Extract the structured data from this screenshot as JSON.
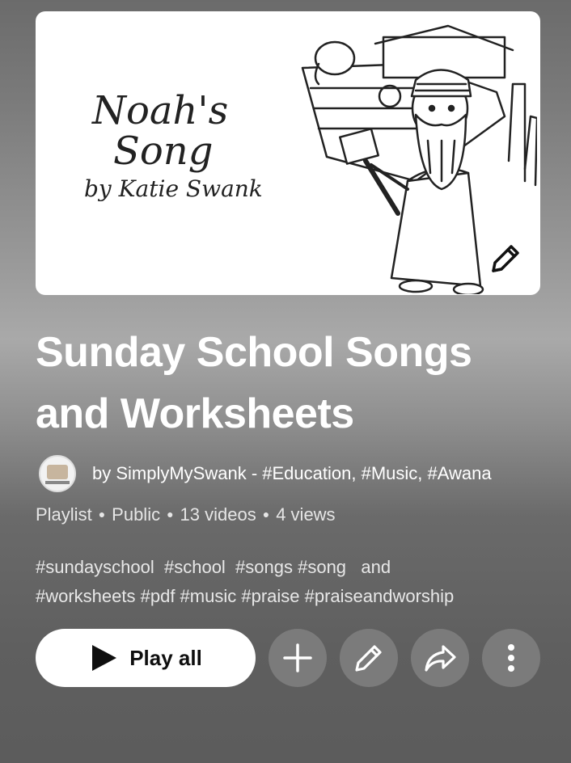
{
  "thumbnail": {
    "title_line1": "Noah's",
    "title_line2": "Song",
    "title_line3": "by Katie Swank",
    "art_icon": "noah-ark-illustration",
    "edit_icon": "pencil-icon"
  },
  "playlist": {
    "title": "Sunday School Songs and Worksheets",
    "owner": "by SimplyMySwank - #Education, #Music, #Awana",
    "meta": {
      "type": "Playlist",
      "visibility": "Public",
      "videos": "13 videos",
      "views": "4 views"
    },
    "description_line1": "#sundayschool  #school  #songs #song   and",
    "description_line2": "#worksheets #pdf #music #praise #praiseandworship"
  },
  "actions": {
    "play_all_label": "Play all",
    "icons": [
      "play-icon",
      "plus-icon",
      "pencil-icon",
      "share-icon",
      "more-vert-icon"
    ]
  },
  "colors": {
    "button_bg": "#ffffff",
    "circle_button_bg": "#7b7b7b",
    "text": "#ffffff"
  }
}
